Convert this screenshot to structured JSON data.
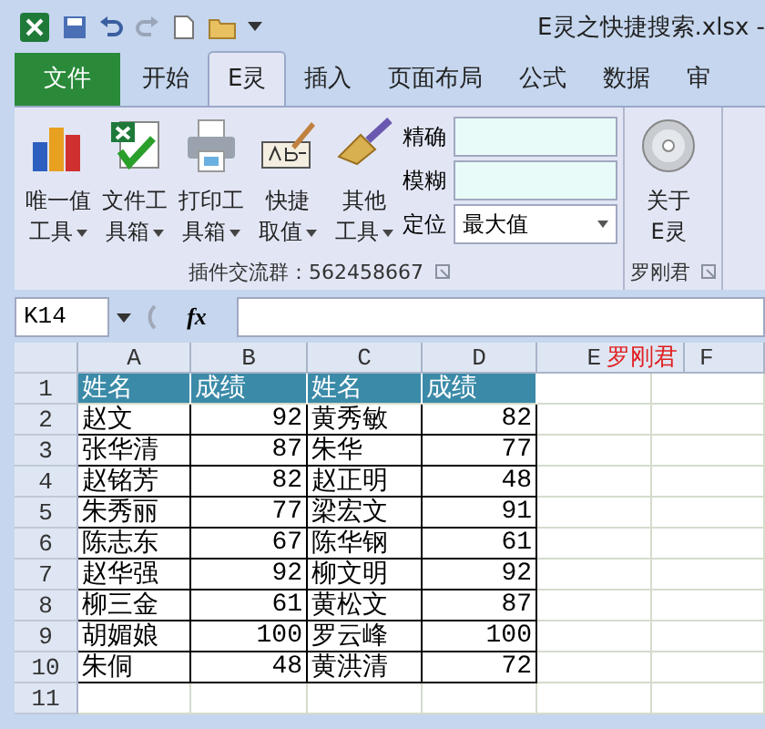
{
  "window": {
    "title": "E灵之快捷搜索.xlsx -"
  },
  "tabs": [
    {
      "label": "文件",
      "kind": "file",
      "selected": false
    },
    {
      "label": "开始",
      "kind": "normal",
      "selected": false
    },
    {
      "label": "E灵",
      "kind": "normal",
      "selected": true
    },
    {
      "label": "插入",
      "kind": "normal",
      "selected": false
    },
    {
      "label": "页面布局",
      "kind": "normal",
      "selected": false
    },
    {
      "label": "公式",
      "kind": "normal",
      "selected": false
    },
    {
      "label": "数据",
      "kind": "normal",
      "selected": false
    },
    {
      "label": "审",
      "kind": "normal",
      "selected": false
    }
  ],
  "ribbon": {
    "groups": [
      {
        "label": "插件交流群：562458667",
        "tools": [
          {
            "kind": "chart",
            "lines": [
              "唯一值",
              "工具"
            ],
            "menu": true
          },
          {
            "kind": "excel",
            "lines": [
              "文件工",
              "具箱"
            ],
            "menu": true
          },
          {
            "kind": "printer",
            "lines": [
              "打印工",
              "具箱"
            ],
            "menu": true
          },
          {
            "kind": "abc",
            "lines": [
              "快捷",
              "取值"
            ],
            "menu": true
          },
          {
            "kind": "broom",
            "lines": [
              "其他",
              "工具"
            ],
            "menu": true
          }
        ],
        "fields": [
          {
            "label": "精确",
            "kind": "text"
          },
          {
            "label": "模糊",
            "kind": "text"
          },
          {
            "label": "定位",
            "kind": "dropdown",
            "value": "最大值"
          }
        ]
      },
      {
        "label": "罗刚君",
        "tools": [
          {
            "kind": "disc",
            "lines": [
              "关于",
              "E灵"
            ],
            "menu": false
          }
        ]
      }
    ]
  },
  "formula_bar": {
    "name_box": "K14",
    "fx": "fx"
  },
  "sheet": {
    "columns": [
      "A",
      "B",
      "C",
      "D",
      "E",
      "F"
    ],
    "note": "罗刚君",
    "rows": [
      {
        "number": "1",
        "kind": "header",
        "cells": [
          "姓名",
          "成绩",
          "姓名",
          "成绩"
        ]
      },
      {
        "number": "2",
        "kind": "data",
        "cells": [
          "赵文",
          "92",
          "黄秀敏",
          "82"
        ]
      },
      {
        "number": "3",
        "kind": "data",
        "cells": [
          "张华清",
          "87",
          "朱华",
          "77"
        ]
      },
      {
        "number": "4",
        "kind": "data",
        "cells": [
          "赵铭芳",
          "82",
          "赵正明",
          "48"
        ]
      },
      {
        "number": "5",
        "kind": "data",
        "cells": [
          "朱秀丽",
          "77",
          "梁宏文",
          "91"
        ]
      },
      {
        "number": "6",
        "kind": "data",
        "cells": [
          "陈志东",
          "67",
          "陈华钢",
          "61"
        ]
      },
      {
        "number": "7",
        "kind": "data",
        "cells": [
          "赵华强",
          "92",
          "柳文明",
          "92"
        ]
      },
      {
        "number": "8",
        "kind": "data",
        "cells": [
          "柳三金",
          "61",
          "黄松文",
          "87"
        ]
      },
      {
        "number": "9",
        "kind": "data",
        "cells": [
          "胡媚娘",
          "100",
          "罗云峰",
          "100"
        ]
      },
      {
        "number": "10",
        "kind": "data",
        "cells": [
          "朱侗",
          "48",
          "黄洪清",
          "72"
        ]
      },
      {
        "number": "11",
        "kind": "empty",
        "cells": []
      }
    ]
  }
}
